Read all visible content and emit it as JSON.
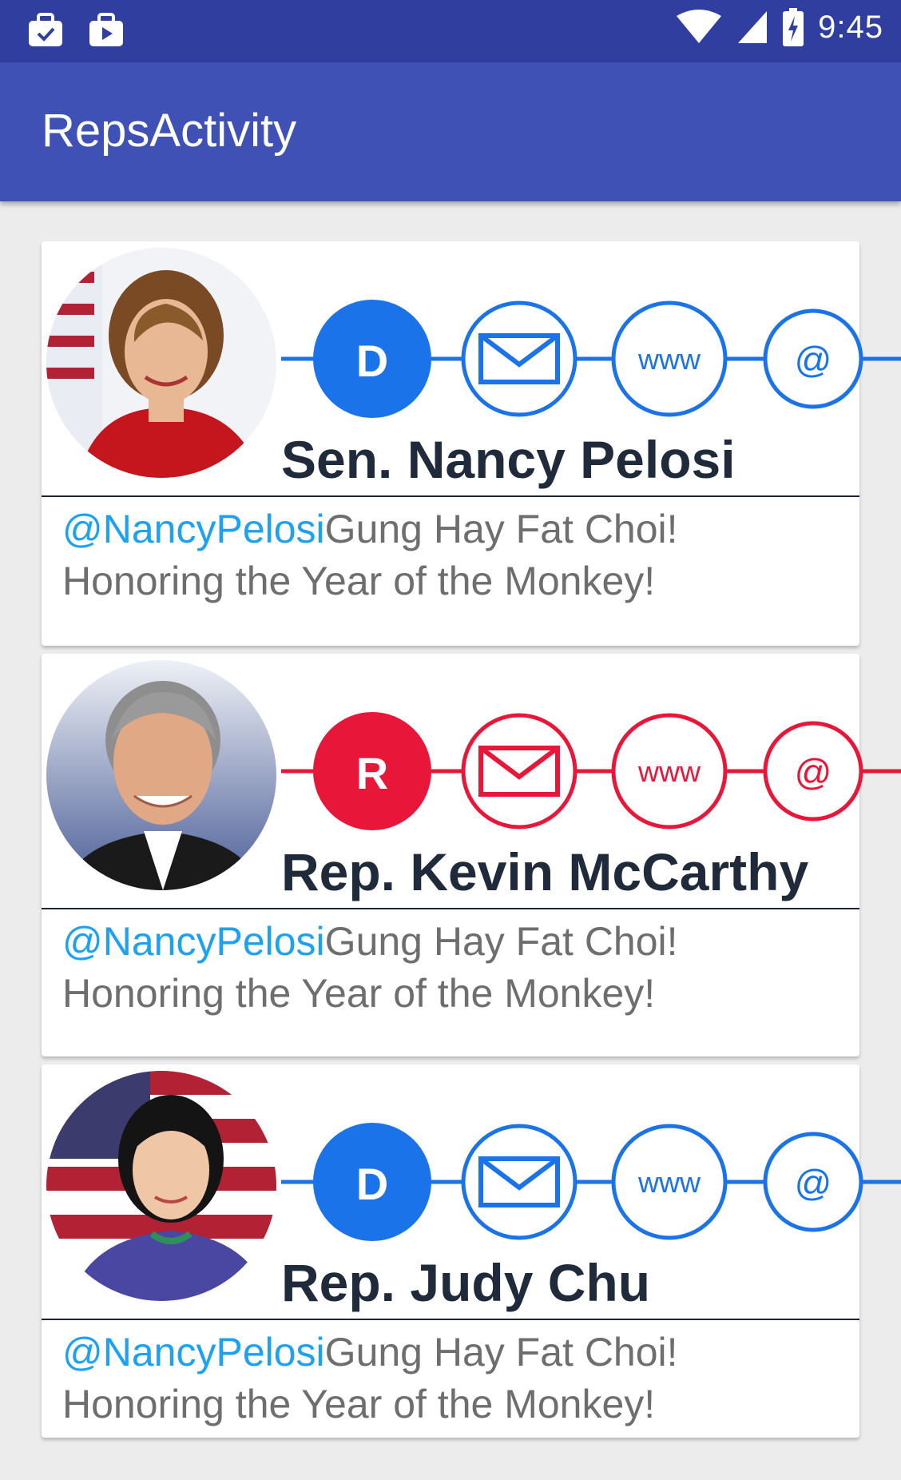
{
  "status_bar": {
    "time": "9:45",
    "icons": [
      "briefcase-check-icon",
      "briefcase-play-icon",
      "wifi-icon",
      "signal-icon",
      "battery-charging-icon"
    ]
  },
  "app_bar": {
    "title": "RepsActivity"
  },
  "colors": {
    "democrat": "#1a73e8",
    "republican": "#e8173a",
    "name_text": "#1f2a3b",
    "tweet_text": "#6e6e6e",
    "handle_text": "#1da1f2"
  },
  "reps": [
    {
      "name": "Sen. Nancy Pelosi",
      "party_letter": "D",
      "party": "democrat",
      "icon_labels": {
        "www": "www",
        "at": "@"
      },
      "tweet": {
        "handle": "@NancyPelosi",
        "text": "Gung Hay Fat Choi! Honoring the Year of the Monkey!"
      }
    },
    {
      "name": "Rep. Kevin McCarthy",
      "party_letter": "R",
      "party": "republican",
      "icon_labels": {
        "www": "www",
        "at": "@"
      },
      "tweet": {
        "handle": "@NancyPelosi",
        "text": "Gung Hay Fat Choi! Honoring the Year of the Monkey!"
      }
    },
    {
      "name": "Rep. Judy Chu",
      "party_letter": "D",
      "party": "democrat",
      "icon_labels": {
        "www": "www",
        "at": "@"
      },
      "tweet": {
        "handle": "@NancyPelosi",
        "text": "Gung Hay Fat Choi! Honoring the Year of the Monkey!"
      }
    }
  ]
}
